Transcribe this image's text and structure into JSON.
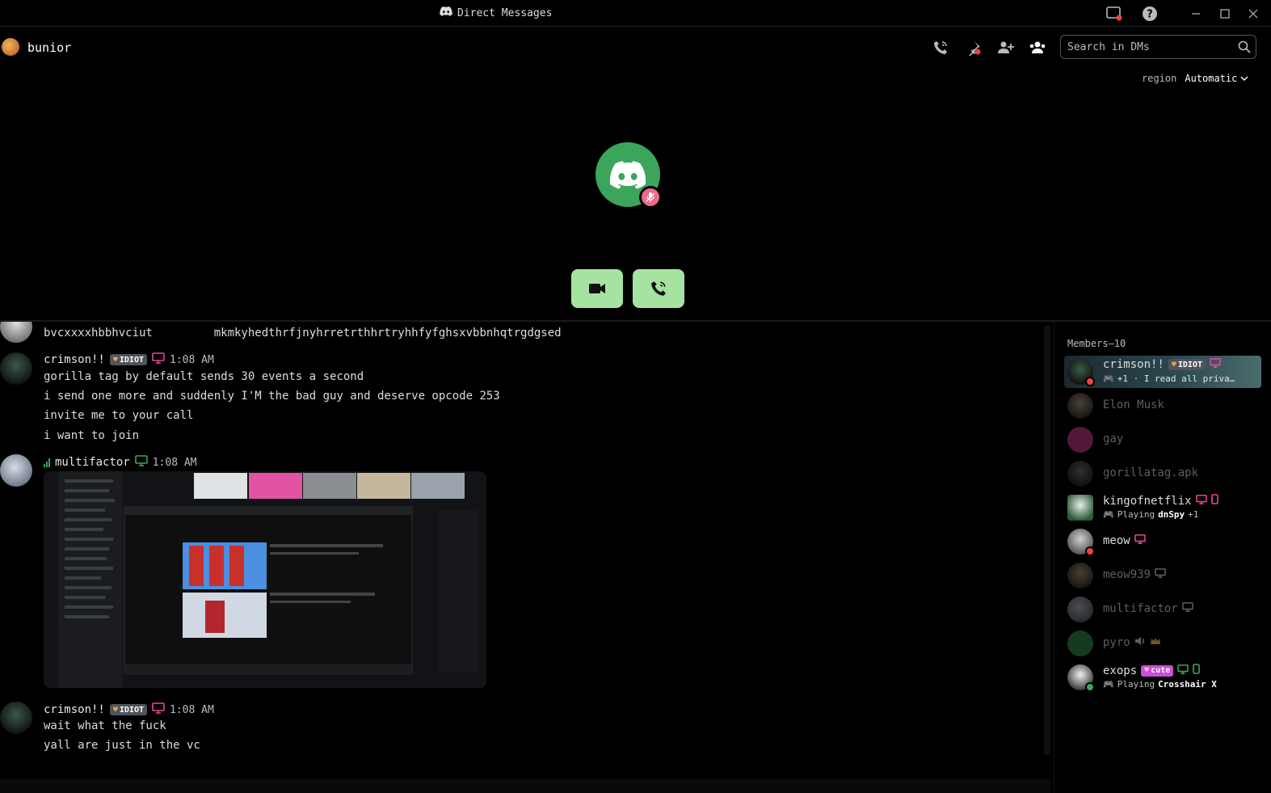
{
  "window": {
    "title": "Direct Messages"
  },
  "header": {
    "username": "bunior",
    "search_placeholder": "Search in DMs"
  },
  "region": {
    "label": "region",
    "value": "Automatic"
  },
  "colors": {
    "accent": "#3ba55c",
    "call_button": "#a6e3a1",
    "mute": "#ed6a8a"
  },
  "messages": [
    {
      "text": "bvcxxxxhbbhvciut         mkmkyhedthrfjnyhrretrthhrtryhhfyfghsxvbbnhqtrgdgsed"
    },
    {
      "author": "crimson!!",
      "tag": "IDIOT",
      "time": "1:08 AM",
      "lines": [
        "gorilla tag by default sends 30 events a second",
        "i send one more and suddenly I'M the bad guy and deserve opcode 253",
        "invite me to your call",
        "i want to join"
      ]
    },
    {
      "author": "multifactor",
      "time": "1:08 AM"
    },
    {
      "author": "crimson!!",
      "tag": "IDIOT",
      "time": "1:08 AM",
      "lines": [
        "wait what the fuck",
        "yall are just in the vc"
      ]
    }
  ],
  "members": {
    "heading": "Members—10",
    "list": [
      {
        "name": "crimson!!",
        "tag": "IDIOT",
        "activity": "+1 · I read all priva…"
      },
      {
        "name": "Elon Musk"
      },
      {
        "name": "gay"
      },
      {
        "name": "gorillatag.apk"
      },
      {
        "name": "kingofnetflix",
        "activity_prefix": "Playing",
        "activity_game": "dnSpy",
        "activity_suffix": "+1"
      },
      {
        "name": "meow"
      },
      {
        "name": "meow939"
      },
      {
        "name": "multifactor"
      },
      {
        "name": "pyro"
      },
      {
        "name": "exops",
        "tag": "cute",
        "activity_prefix": "Playing",
        "activity_game": "Crosshair X"
      }
    ]
  }
}
